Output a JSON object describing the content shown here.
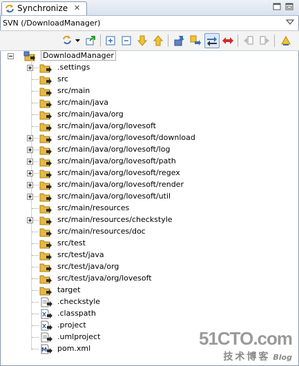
{
  "tab": {
    "label": "Synchronize",
    "close": "✕"
  },
  "view": {
    "subtitle": "SVN (/DownloadManager)"
  },
  "toolbar": {
    "buttons": [
      {
        "name": "synchronize-dropdown-button",
        "icon": "sync-icon"
      },
      {
        "name": "pin-button",
        "icon": "pin-icon"
      },
      {
        "name": "expand-all-button",
        "icon": "expand-all-icon"
      },
      {
        "name": "collapse-all-button",
        "icon": "collapse-all-icon"
      },
      {
        "name": "next-difference-button",
        "icon": "arrow-down-icon"
      },
      {
        "name": "previous-difference-button",
        "icon": "arrow-up-icon"
      },
      {
        "name": "incoming-mode-button",
        "icon": "incoming-icon"
      },
      {
        "name": "outgoing-mode-button",
        "icon": "outgoing-icon"
      },
      {
        "name": "incoming-outgoing-mode-button",
        "icon": "both-ways-icon"
      },
      {
        "name": "conflicts-mode-button",
        "icon": "conflict-icon"
      },
      {
        "name": "commit-button",
        "icon": "commit-icon"
      },
      {
        "name": "update-button",
        "icon": "update-icon"
      },
      {
        "name": "view-menu-button",
        "icon": "view-menu-icon"
      }
    ]
  },
  "tree": {
    "root": {
      "label": "DownloadManager"
    },
    "items": [
      {
        "label": ".settings",
        "kind": "folder",
        "expandable": true
      },
      {
        "label": "src",
        "kind": "folder",
        "expandable": false
      },
      {
        "label": "src/main",
        "kind": "folder",
        "expandable": false
      },
      {
        "label": "src/main/java",
        "kind": "folder",
        "expandable": false
      },
      {
        "label": "src/main/java/org",
        "kind": "folder",
        "expandable": false
      },
      {
        "label": "src/main/java/org/lovesoft",
        "kind": "folder",
        "expandable": false
      },
      {
        "label": "src/main/java/org/lovesoft/download",
        "kind": "folder",
        "expandable": true
      },
      {
        "label": "src/main/java/org/lovesoft/log",
        "kind": "folder",
        "expandable": true
      },
      {
        "label": "src/main/java/org/lovesoft/path",
        "kind": "folder",
        "expandable": true
      },
      {
        "label": "src/main/java/org/lovesoft/regex",
        "kind": "folder",
        "expandable": true
      },
      {
        "label": "src/main/java/org/lovesoft/render",
        "kind": "folder",
        "expandable": true
      },
      {
        "label": "src/main/java/org/lovesoft/util",
        "kind": "folder",
        "expandable": true
      },
      {
        "label": "src/main/resources",
        "kind": "folder",
        "expandable": false
      },
      {
        "label": "src/main/resources/checkstyle",
        "kind": "folder",
        "expandable": true
      },
      {
        "label": "src/main/resources/doc",
        "kind": "folder",
        "expandable": false
      },
      {
        "label": "src/test",
        "kind": "folder",
        "expandable": false
      },
      {
        "label": "src/test/java",
        "kind": "folder",
        "expandable": false
      },
      {
        "label": "src/test/java/org",
        "kind": "folder",
        "expandable": false
      },
      {
        "label": "src/test/java/org/lovesoft",
        "kind": "folder",
        "expandable": false
      },
      {
        "label": "target",
        "kind": "folder",
        "expandable": false
      },
      {
        "label": ".checkstyle",
        "kind": "text-file",
        "expandable": false
      },
      {
        "label": ".classpath",
        "kind": "xml-file",
        "expandable": false
      },
      {
        "label": ".project",
        "kind": "xml-file",
        "expandable": false
      },
      {
        "label": ".umlproject",
        "kind": "text-file",
        "expandable": false
      },
      {
        "label": "pom.xml",
        "kind": "maven-file",
        "expandable": false
      }
    ]
  },
  "watermark": {
    "logo": "51CTO.com",
    "sub": "技术博客",
    "blog": "Blog"
  },
  "colors": {
    "folder": "#e8b840",
    "arrow": "#2b2b2b",
    "accent_blue": "#3a6fb7",
    "conflict_red": "#d42828"
  }
}
